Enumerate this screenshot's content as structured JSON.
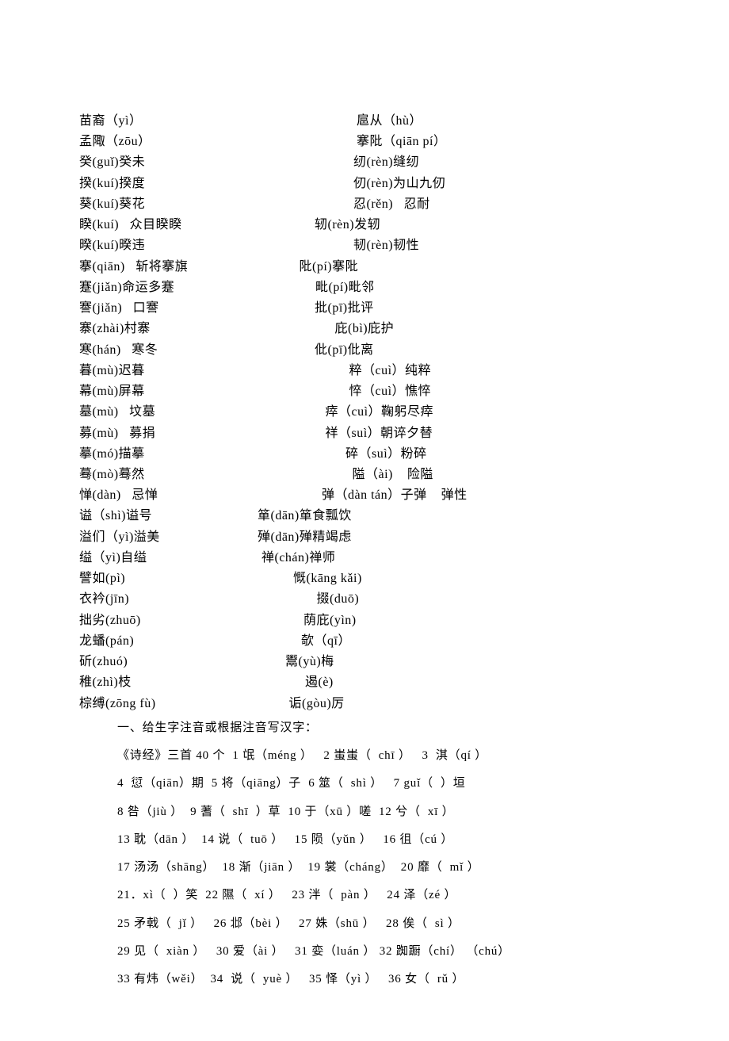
{
  "pairs": [
    {
      "l": "苗裔（yì）",
      "r": "扈从（hù）"
    },
    {
      "l": "孟陬（zōu）",
      "r": "搴阰（qiān pí）"
    },
    {
      "l": "癸(guǐ)癸未",
      "r": "        纫(rèn)缝纫"
    },
    {
      "l": "揆(kuí)揆度",
      "r": "        仞(rèn)为山九仞"
    },
    {
      "l": "葵(kuí)葵花",
      "r": "        忍(rěn)   忍耐"
    },
    {
      "l": "睽(kuí)   众目睽睽",
      "r": "      轫(rèn)发轫"
    },
    {
      "l": "暌(kuí)暌违",
      "r": "        韧(rèn)韧性"
    },
    {
      "l": "搴(qiān)   斩将搴旗",
      "r": "     阰(pí)搴阰"
    },
    {
      "l": "蹇(jiǎn)命运多蹇",
      "r": "    毗(pí)毗邻"
    },
    {
      "l": "謇(jiǎn)   口謇",
      "r": "      批(pī)批评"
    },
    {
      "l": "寨(zhài)村寨",
      "r": "     庇(bì)庇护"
    },
    {
      "l": "寒(hán)   寒冬",
      "r": "      仳(pī)仳离"
    },
    {
      "l": "暮(mù)迟暮",
      "r": "         粹（cuì）纯粹"
    },
    {
      "l": "幕(mù)屏幕",
      "r": "         悴（cuì）憔悴"
    },
    {
      "l": "墓(mù)   坟墓",
      "r": "         瘁（cuì）鞠躬尽瘁"
    },
    {
      "l": "募(mù)   募捐",
      "r": "         祥（suì）朝谇夕替"
    },
    {
      "l": "摹(mó)描摹",
      "r": "        碎（suì）粉碎"
    },
    {
      "l": "蓦(mò)蓦然",
      "r": "           隘（ài)    险隘"
    },
    {
      "l": "惮(dàn)   忌惮",
      "r": "        弹（dàn tán）子弹    弹性"
    },
    {
      "l": "谥（shì)谥号",
      "r": "箪(dān)箪食瓢饮"
    },
    {
      "l": "溢们（yì)溢美",
      "r": "殚(dān)殚精竭虑"
    },
    {
      "l": "缢（yì)自缢",
      "r": "禅(chán)禅师"
    },
    {
      "l": "譬如(pì)",
      "r": "慨(kāng kǎi)"
    },
    {
      "l": "衣衿(jīn)",
      "r": " 掇(duō)"
    },
    {
      "l": "拙劣(zhuō)",
      "r": "    荫庇(yìn)"
    },
    {
      "l": "龙蟠(pán)",
      "r": "欹（qī）"
    },
    {
      "l": "斫(zhuó)",
      "r": "鬻(yù)梅"
    },
    {
      "l": "稚(zhì)枝",
      "r": "遏(è)"
    },
    {
      "l": "棕缚(zōng fù)",
      "r": " 诟(gòu)厉"
    }
  ],
  "col_right_offsets": [
    125,
    125,
    85,
    85,
    85,
    45,
    85,
    30,
    55,
    45,
    75,
    45,
    75,
    75,
    45,
    45,
    75,
    70,
    45,
    0,
    0,
    5,
    45,
    70,
    40,
    55,
    35,
    60,
    35
  ],
  "section2": {
    "title": "一、给生字注音或根据注音写汉字：",
    "lines": [
      "《诗经》三首 40 个  1 氓（méng ）   2 蚩蚩（  chī ）   3  淇（qí ）",
      "4  愆（qiān）期  5 将（qiāng）子  6 筮（  shì ）   7 guǐ（  ）垣",
      "8 咎（jiù ）  9 蓍（  shī  ）草  10 于（xū ）嗟  12 兮（  xī ）",
      "13 耽（dān ）  14 说（  tuō ）   15 陨（yǔn ）   16 徂（cú ）",
      "17 汤汤（shāng）  18 渐（jiān ）  19 裳（cháng）  20 靡（  mǐ ）",
      "21．xì（  ）笑  22 隰（  xí ）   23 泮（  pàn ）   24 泽（zé ）",
      "25 矛戟（  jǐ ）   26 邶（bèi ）   27 姝（shū ）   28 俟（  sì ）",
      "29 见（  xiàn ）   30 爱（ài ）   31 娈（luán ） 32 踟蹰（chí） （chú）",
      "33 有炜（wěi）  34  说（  yuè ）   35 怿（yì ）   36 女（  rǔ ）"
    ]
  }
}
